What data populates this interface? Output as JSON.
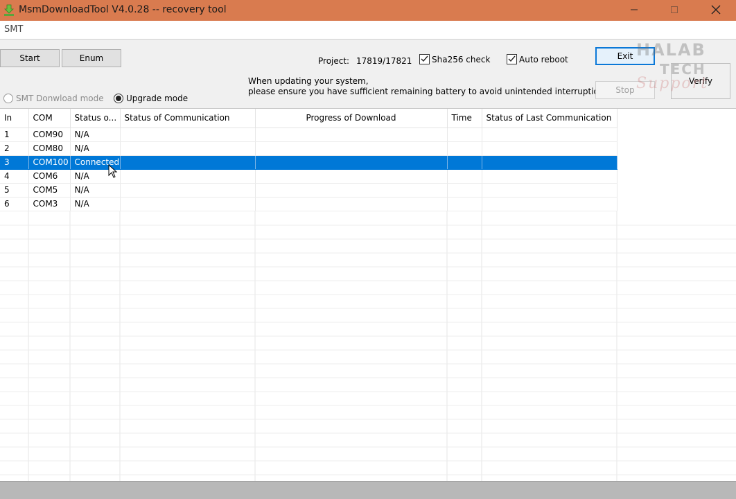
{
  "window": {
    "title": "MsmDownloadTool V4.0.28 -- recovery tool",
    "icons": {
      "app": "download-arrow-icon",
      "minimize": "minimize-icon",
      "maximize": "maximize-icon",
      "close": "close-icon"
    }
  },
  "menu": {
    "item": "SMT"
  },
  "toolbar": {
    "start_label": "Start",
    "enum_label": "Enum",
    "exit_label": "Exit",
    "verify_label": "Verify",
    "stop_label": "Stop"
  },
  "project": {
    "label": "Project:",
    "value": "17819/17821"
  },
  "options": {
    "sha256_label": "Sha256 check",
    "sha256_checked": true,
    "auto_reboot_label": "Auto reboot",
    "auto_reboot_checked": true
  },
  "notice": {
    "line1": "When updating your system,",
    "line2": "please ensure you have sufficient remaining battery to avoid unintended interruptions."
  },
  "modes": {
    "smt_label": "SMT Donwload mode",
    "smt_selected": false,
    "smt_enabled": false,
    "upgrade_label": "Upgrade mode",
    "upgrade_selected": true
  },
  "table": {
    "headers": [
      "In",
      "COM",
      "Status o...",
      "Status of Communication",
      "Progress of Download",
      "Time",
      "Status of Last Communication"
    ],
    "rows": [
      [
        "1",
        "COM90",
        "N/A",
        "",
        "",
        "",
        ""
      ],
      [
        "2",
        "COM80",
        "N/A",
        "",
        "",
        "",
        ""
      ],
      [
        "3",
        "COM100",
        "Connected",
        "",
        "",
        "",
        ""
      ],
      [
        "4",
        "COM6",
        "N/A",
        "",
        "",
        "",
        ""
      ],
      [
        "5",
        "COM5",
        "N/A",
        "",
        "",
        "",
        ""
      ],
      [
        "6",
        "COM3",
        "N/A",
        "",
        "",
        "",
        ""
      ]
    ],
    "selected_row": 2,
    "selection_color": "#0078d7"
  },
  "watermark": {
    "line1": "HALAB",
    "line2": "TECH",
    "line3": "Support"
  },
  "colors": {
    "titlebar": "#d97b4f",
    "accent": "#0078d7"
  }
}
